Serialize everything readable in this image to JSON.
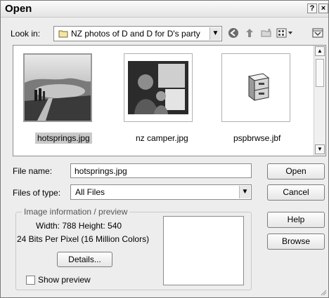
{
  "window": {
    "title": "Open",
    "help_glyph": "?",
    "close_glyph": "×"
  },
  "look_in": {
    "label": "Look in:",
    "value": "NZ photos of D and D for D's party"
  },
  "nav_icons": [
    "back-icon",
    "up-folder-icon",
    "new-folder-icon",
    "view-menu-icon",
    "save-icon"
  ],
  "files": [
    {
      "name": "hotsprings.jpg",
      "selected": true,
      "thumb": "photo-hotsprings"
    },
    {
      "name": "nz camper.jpg",
      "selected": false,
      "thumb": "photo-camper"
    },
    {
      "name": "pspbrwse.jbf",
      "selected": false,
      "thumb": "file-cabinet-icon"
    }
  ],
  "file_name": {
    "label": "File name:",
    "value": "hotsprings.jpg"
  },
  "file_type": {
    "label": "Files of type:",
    "value": "All Files"
  },
  "buttons": {
    "open": "Open",
    "cancel": "Cancel",
    "help": "Help",
    "browse": "Browse"
  },
  "image_info": {
    "legend": "Image information / preview",
    "dimensions": "Width: 788   Height: 540",
    "bits": "24 Bits Per Pixel (16 Million Colors)",
    "details_label": "Details...",
    "show_preview_label": "Show preview",
    "show_preview_checked": false
  },
  "colors": {
    "selection": "#c9c9c9",
    "dialog_bg": "#ededed"
  }
}
